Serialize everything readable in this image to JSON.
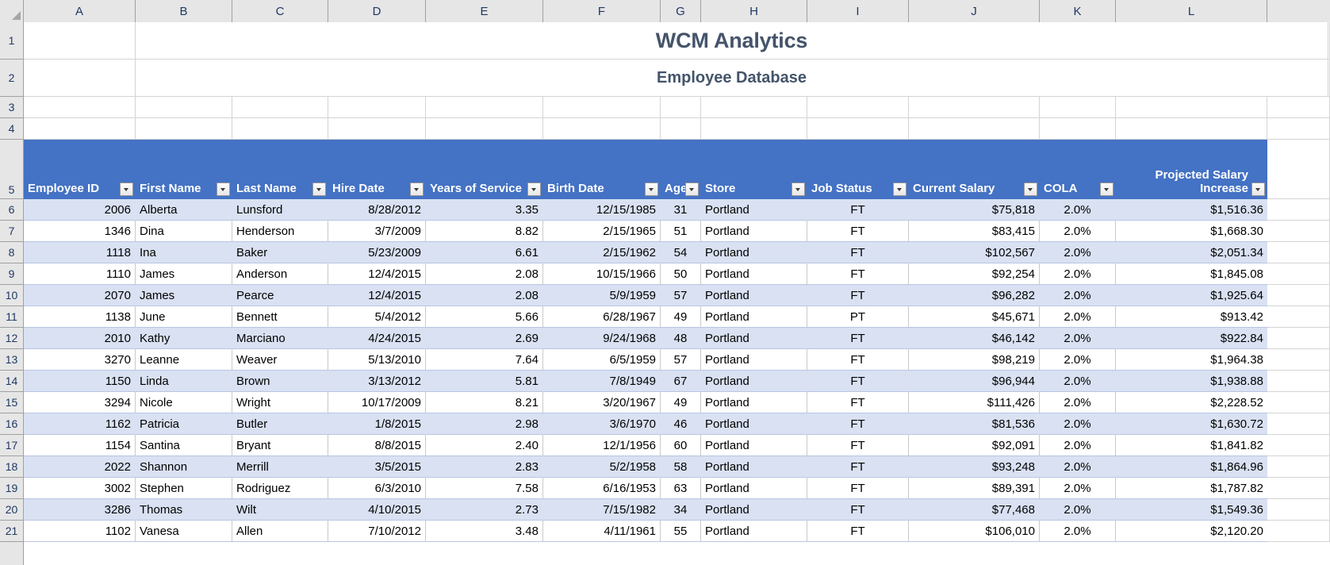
{
  "app": {
    "type": "spreadsheet",
    "title": "WCM Analytics",
    "subtitle": "Employee Database"
  },
  "column_letters": [
    "A",
    "B",
    "C",
    "D",
    "E",
    "F",
    "G",
    "H",
    "I",
    "J",
    "K",
    "L"
  ],
  "row_numbers": [
    "1",
    "2",
    "3",
    "4",
    "5",
    "6",
    "7",
    "8",
    "9",
    "10",
    "11",
    "12",
    "13",
    "14",
    "15",
    "16",
    "17",
    "18",
    "19",
    "20",
    "21"
  ],
  "table": {
    "header_row_number": "5",
    "headers": [
      {
        "label": "Employee ID",
        "align": "left",
        "filter": true
      },
      {
        "label": "First Name",
        "align": "left",
        "filter": true
      },
      {
        "label": "Last Name",
        "align": "left",
        "filter": true
      },
      {
        "label": "Hire Date",
        "align": "left",
        "filter": true
      },
      {
        "label": "Years of Service",
        "align": "left",
        "filter": true
      },
      {
        "label": "Birth Date",
        "align": "left",
        "filter": true
      },
      {
        "label": "Age",
        "align": "left",
        "filter": true
      },
      {
        "label": "Store",
        "align": "left",
        "filter": true
      },
      {
        "label": "Job Status",
        "align": "left",
        "filter": true
      },
      {
        "label": "Current Salary",
        "align": "left",
        "filter": true
      },
      {
        "label": "COLA",
        "align": "left",
        "filter": true
      },
      {
        "label": "Projected Salary Increase",
        "align": "right",
        "filter": true
      }
    ],
    "rows": [
      {
        "row": "6",
        "band": true,
        "employee_id": "2006",
        "first_name": "Alberta",
        "last_name": "Lunsford",
        "hire_date": "8/28/2012",
        "years_of_service": "3.35",
        "birth_date": "12/15/1985",
        "age": "31",
        "store": "Portland",
        "job_status": "FT",
        "current_salary": "$75,818",
        "cola": "2.0%",
        "projected_increase": "$1,516.36"
      },
      {
        "row": "7",
        "band": false,
        "employee_id": "1346",
        "first_name": "Dina",
        "last_name": "Henderson",
        "hire_date": "3/7/2009",
        "years_of_service": "8.82",
        "birth_date": "2/15/1965",
        "age": "51",
        "store": "Portland",
        "job_status": "FT",
        "current_salary": "$83,415",
        "cola": "2.0%",
        "projected_increase": "$1,668.30"
      },
      {
        "row": "8",
        "band": true,
        "employee_id": "1118",
        "first_name": "Ina",
        "last_name": "Baker",
        "hire_date": "5/23/2009",
        "years_of_service": "6.61",
        "birth_date": "2/15/1962",
        "age": "54",
        "store": "Portland",
        "job_status": "FT",
        "current_salary": "$102,567",
        "cola": "2.0%",
        "projected_increase": "$2,051.34"
      },
      {
        "row": "9",
        "band": false,
        "employee_id": "1110",
        "first_name": "James",
        "last_name": "Anderson",
        "hire_date": "12/4/2015",
        "years_of_service": "2.08",
        "birth_date": "10/15/1966",
        "age": "50",
        "store": "Portland",
        "job_status": "FT",
        "current_salary": "$92,254",
        "cola": "2.0%",
        "projected_increase": "$1,845.08"
      },
      {
        "row": "10",
        "band": true,
        "employee_id": "2070",
        "first_name": "James",
        "last_name": "Pearce",
        "hire_date": "12/4/2015",
        "years_of_service": "2.08",
        "birth_date": "5/9/1959",
        "age": "57",
        "store": "Portland",
        "job_status": "FT",
        "current_salary": "$96,282",
        "cola": "2.0%",
        "projected_increase": "$1,925.64"
      },
      {
        "row": "11",
        "band": false,
        "employee_id": "1138",
        "first_name": "June",
        "last_name": "Bennett",
        "hire_date": "5/4/2012",
        "years_of_service": "5.66",
        "birth_date": "6/28/1967",
        "age": "49",
        "store": "Portland",
        "job_status": "PT",
        "current_salary": "$45,671",
        "cola": "2.0%",
        "projected_increase": "$913.42"
      },
      {
        "row": "12",
        "band": true,
        "employee_id": "2010",
        "first_name": "Kathy",
        "last_name": "Marciano",
        "hire_date": "4/24/2015",
        "years_of_service": "2.69",
        "birth_date": "9/24/1968",
        "age": "48",
        "store": "Portland",
        "job_status": "FT",
        "current_salary": "$46,142",
        "cola": "2.0%",
        "projected_increase": "$922.84"
      },
      {
        "row": "13",
        "band": false,
        "employee_id": "3270",
        "first_name": "Leanne",
        "last_name": "Weaver",
        "hire_date": "5/13/2010",
        "years_of_service": "7.64",
        "birth_date": "6/5/1959",
        "age": "57",
        "store": "Portland",
        "job_status": "FT",
        "current_salary": "$98,219",
        "cola": "2.0%",
        "projected_increase": "$1,964.38"
      },
      {
        "row": "14",
        "band": true,
        "employee_id": "1150",
        "first_name": "Linda",
        "last_name": "Brown",
        "hire_date": "3/13/2012",
        "years_of_service": "5.81",
        "birth_date": "7/8/1949",
        "age": "67",
        "store": "Portland",
        "job_status": "FT",
        "current_salary": "$96,944",
        "cola": "2.0%",
        "projected_increase": "$1,938.88"
      },
      {
        "row": "15",
        "band": false,
        "employee_id": "3294",
        "first_name": "Nicole",
        "last_name": "Wright",
        "hire_date": "10/17/2009",
        "years_of_service": "8.21",
        "birth_date": "3/20/1967",
        "age": "49",
        "store": "Portland",
        "job_status": "FT",
        "current_salary": "$111,426",
        "cola": "2.0%",
        "projected_increase": "$2,228.52"
      },
      {
        "row": "16",
        "band": true,
        "employee_id": "1162",
        "first_name": "Patricia",
        "last_name": "Butler",
        "hire_date": "1/8/2015",
        "years_of_service": "2.98",
        "birth_date": "3/6/1970",
        "age": "46",
        "store": "Portland",
        "job_status": "FT",
        "current_salary": "$81,536",
        "cola": "2.0%",
        "projected_increase": "$1,630.72"
      },
      {
        "row": "17",
        "band": false,
        "employee_id": "1154",
        "first_name": "Santina",
        "last_name": "Bryant",
        "hire_date": "8/8/2015",
        "years_of_service": "2.40",
        "birth_date": "12/1/1956",
        "age": "60",
        "store": "Portland",
        "job_status": "FT",
        "current_salary": "$92,091",
        "cola": "2.0%",
        "projected_increase": "$1,841.82"
      },
      {
        "row": "18",
        "band": true,
        "employee_id": "2022",
        "first_name": "Shannon",
        "last_name": "Merrill",
        "hire_date": "3/5/2015",
        "years_of_service": "2.83",
        "birth_date": "5/2/1958",
        "age": "58",
        "store": "Portland",
        "job_status": "FT",
        "current_salary": "$93,248",
        "cola": "2.0%",
        "projected_increase": "$1,864.96"
      },
      {
        "row": "19",
        "band": false,
        "employee_id": "3002",
        "first_name": "Stephen",
        "last_name": "Rodriguez",
        "hire_date": "6/3/2010",
        "years_of_service": "7.58",
        "birth_date": "6/16/1953",
        "age": "63",
        "store": "Portland",
        "job_status": "FT",
        "current_salary": "$89,391",
        "cola": "2.0%",
        "projected_increase": "$1,787.82"
      },
      {
        "row": "20",
        "band": true,
        "employee_id": "3286",
        "first_name": "Thomas",
        "last_name": "Wilt",
        "hire_date": "4/10/2015",
        "years_of_service": "2.73",
        "birth_date": "7/15/1982",
        "age": "34",
        "store": "Portland",
        "job_status": "FT",
        "current_salary": "$77,468",
        "cola": "2.0%",
        "projected_increase": "$1,549.36"
      },
      {
        "row": "21",
        "band": false,
        "employee_id": "1102",
        "first_name": "Vanesa",
        "last_name": "Allen",
        "hire_date": "7/10/2012",
        "years_of_service": "3.48",
        "birth_date": "4/11/1961",
        "age": "55",
        "store": "Portland",
        "job_status": "FT",
        "current_salary": "$106,010",
        "cola": "2.0%",
        "projected_increase": "$2,120.20"
      }
    ]
  },
  "colors": {
    "header_fill": "#4472C4",
    "band_fill": "#D9E1F2",
    "title_text": "#44546A",
    "gutter_fill": "#E6E6E6"
  },
  "icons": {
    "filter_dropdown": "chevron-down-icon",
    "select_all": "select-all-corner-icon"
  }
}
